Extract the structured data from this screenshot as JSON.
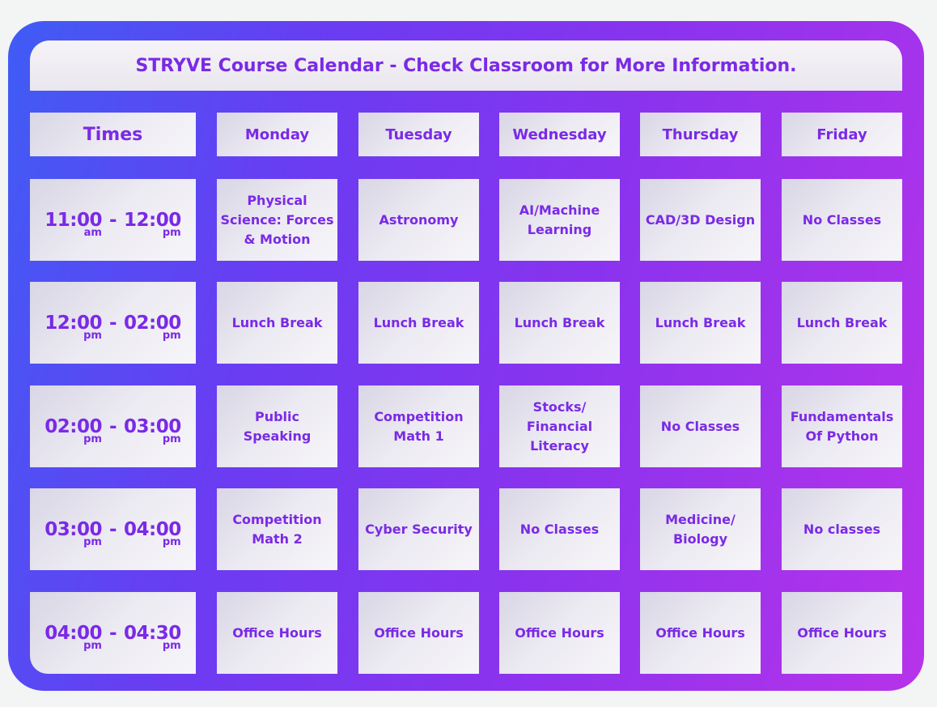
{
  "title": "STRYVE Course Calendar - Check Classroom for More Information.",
  "times_header": "Times",
  "days": [
    "Monday",
    "Tuesday",
    "Wednesday",
    "Thursday",
    "Friday"
  ],
  "rows": [
    {
      "time": {
        "start": "11:00",
        "start_unit": "am",
        "end": "12:00",
        "end_unit": "pm",
        "dash": "-"
      },
      "courses": [
        "Physical Science: Forces & Motion",
        "Astronomy",
        "AI/Machine Learning",
        "CAD/3D Design",
        "No Classes"
      ]
    },
    {
      "time": {
        "start": "12:00",
        "start_unit": "pm",
        "end": "02:00",
        "end_unit": "pm",
        "dash": "-"
      },
      "courses": [
        "Lunch Break",
        "Lunch Break",
        "Lunch Break",
        "Lunch Break",
        "Lunch Break"
      ]
    },
    {
      "time": {
        "start": "02:00",
        "start_unit": "pm",
        "end": "03:00",
        "end_unit": "pm",
        "dash": "-"
      },
      "courses": [
        "Public Speaking",
        "Competition Math 1",
        "Stocks/ Financial Literacy",
        "No Classes",
        "Fundamentals Of Python"
      ]
    },
    {
      "time": {
        "start": "03:00",
        "start_unit": "pm",
        "end": "04:00",
        "end_unit": "pm",
        "dash": "-"
      },
      "courses": [
        "Competition Math 2",
        "Cyber Security",
        "No Classes",
        "Medicine/ Biology",
        "No classes"
      ]
    },
    {
      "time": {
        "start": "04:00",
        "start_unit": "pm",
        "end": "04:30",
        "end_unit": "pm",
        "dash": "-"
      },
      "courses": [
        "Office Hours",
        "Office Hours",
        "Office Hours",
        "Office Hours",
        "Office Hours"
      ]
    }
  ],
  "colors": {
    "text": "#7a2ae6",
    "gradient_start": "#3f5cf5",
    "gradient_end": "#b733ea",
    "cell_background": "#eeecf3",
    "page_background": "#f3f4f4"
  }
}
